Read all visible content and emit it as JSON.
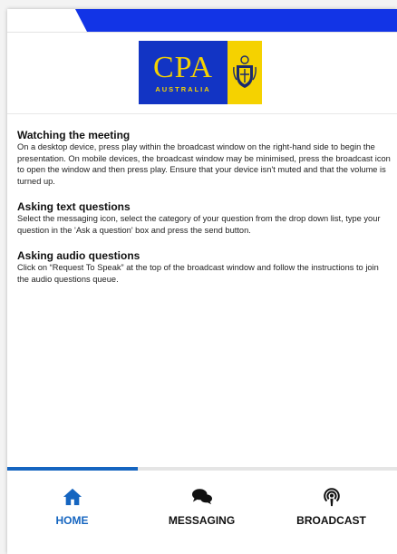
{
  "logo": {
    "main_text": "CPA",
    "sub_text": "AUSTRALIA"
  },
  "colors": {
    "brand_blue": "#1234c4",
    "brand_yellow": "#f5d200",
    "accent_blue": "#1565c0"
  },
  "sections": [
    {
      "title": "Watching the meeting",
      "body": "On a desktop device, press play within the broadcast window on the right-hand side to begin the presentation. On mobile devices, the broadcast window may be minimised, press the broadcast icon to open the window and then press play. Ensure that your device isn't muted and that the volume is turned up."
    },
    {
      "title": "Asking text questions",
      "body": "Select the messaging icon, select the category of your question from the drop down list, type your question in the 'Ask a question' box and press the send button."
    },
    {
      "title": "Asking audio questions",
      "body": "Click on “Request To Speak” at the top of the broadcast window and follow the instructions to join the audio questions queue."
    }
  ],
  "nav": {
    "home": {
      "label": "HOME",
      "icon": "home-icon",
      "active": true
    },
    "messaging": {
      "label": "MESSAGING",
      "icon": "chat-bubbles-icon"
    },
    "broadcast": {
      "label": "BROADCAST",
      "icon": "podcast-icon"
    }
  }
}
